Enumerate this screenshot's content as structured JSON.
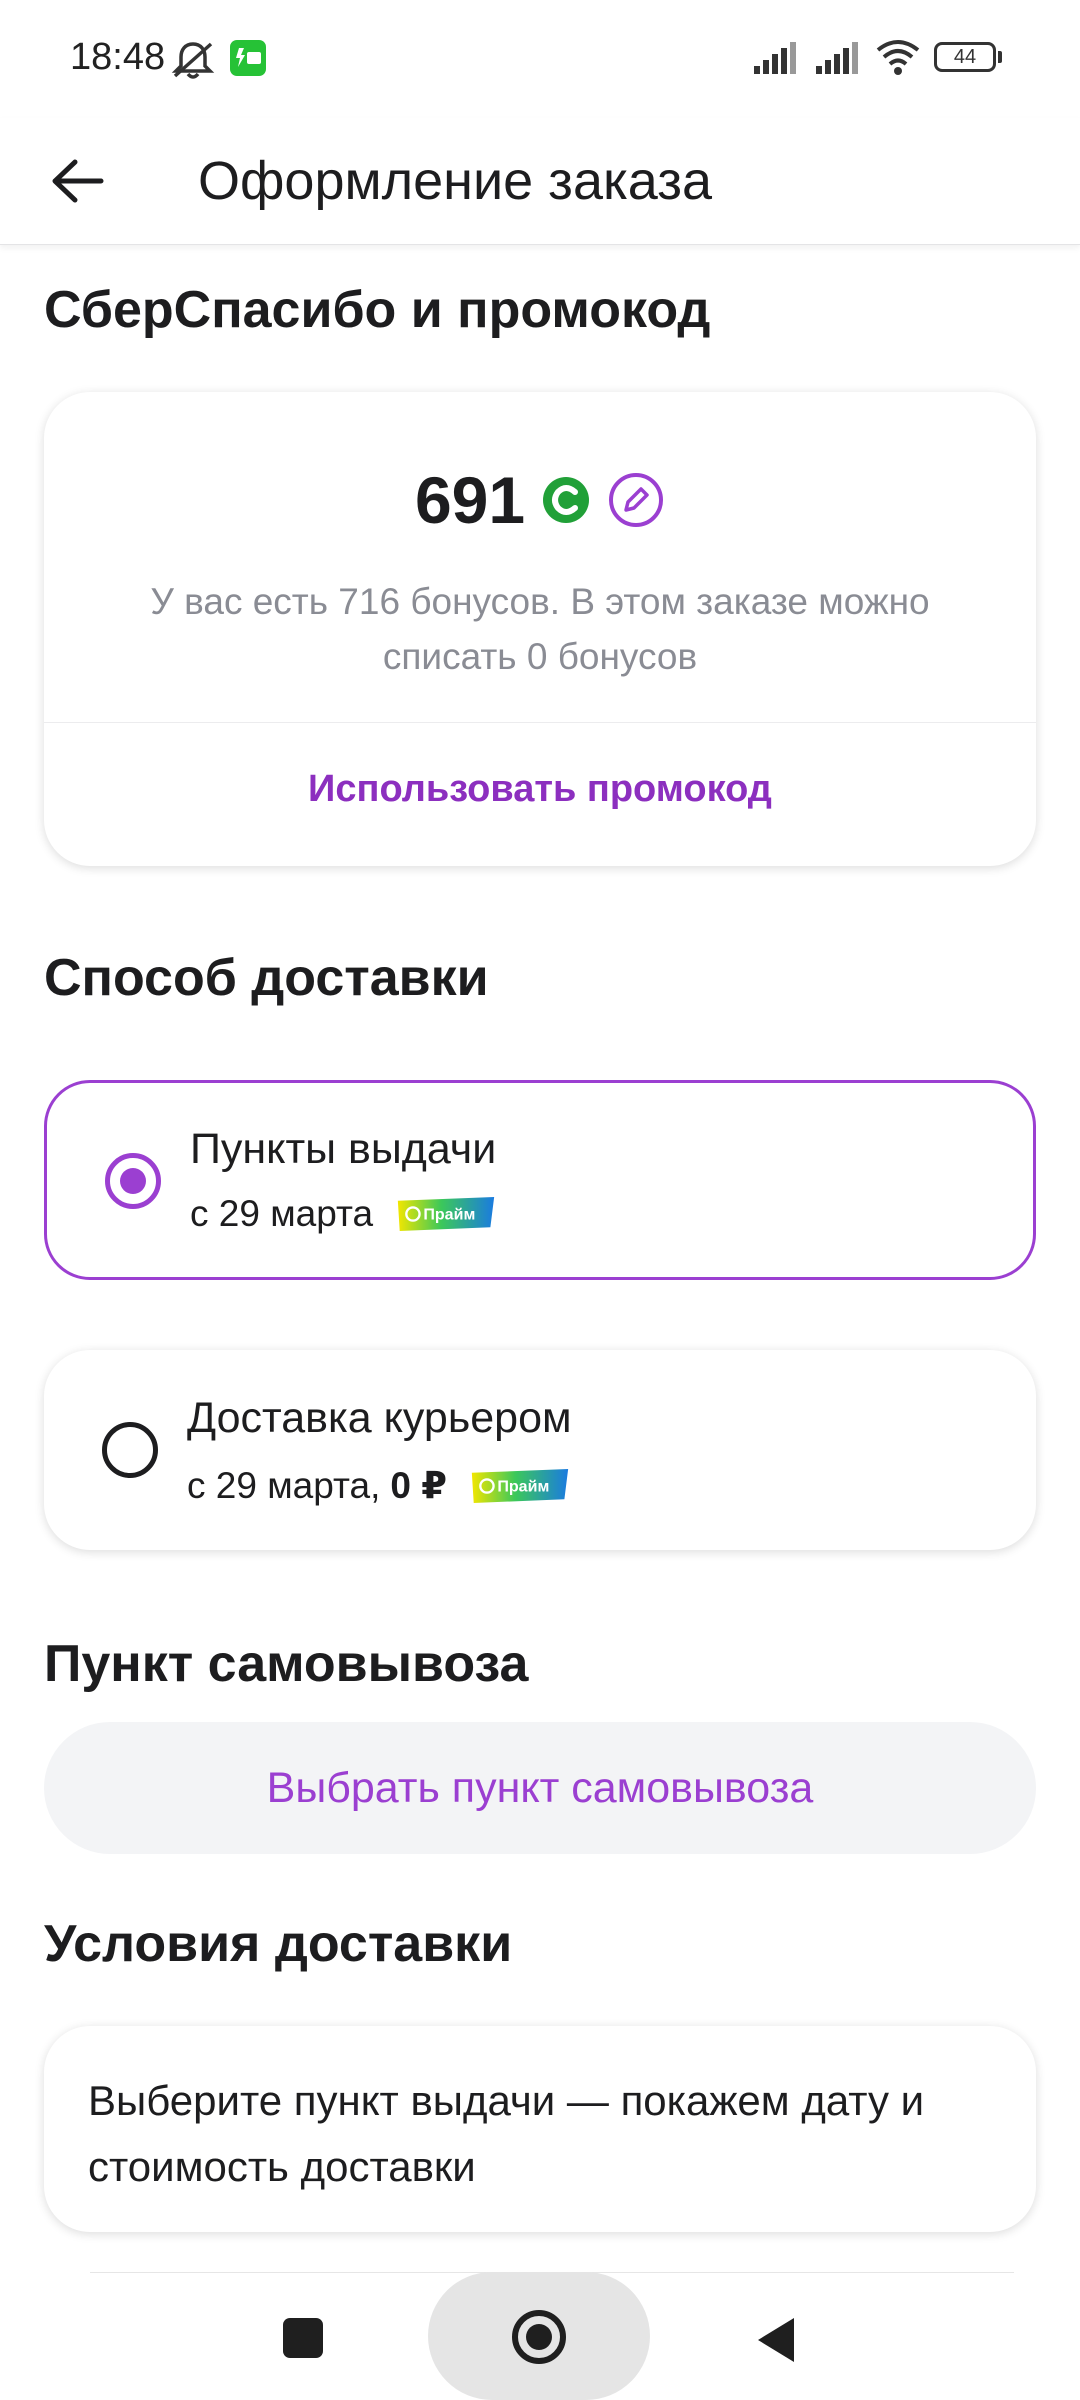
{
  "status_bar": {
    "time": "18:48",
    "battery": "44"
  },
  "app_bar": {
    "title": "Оформление заказа"
  },
  "bonus_section": {
    "title": "СберСпасибо и промокод",
    "bonus_value": "691",
    "bonus_text": "У вас есть 716 бонусов. В этом заказе можно списать 0 бонусов",
    "promo_link": "Использовать промокод"
  },
  "delivery_section": {
    "title": "Способ доставки",
    "options": [
      {
        "title": "Пункты выдачи",
        "subtitle": "с 29 марта",
        "price": "",
        "badge": "Прайм",
        "selected": true
      },
      {
        "title": "Доставка курьером",
        "subtitle": "с 29 марта,",
        "price": "0 ₽",
        "badge": "Прайм",
        "selected": false
      }
    ]
  },
  "pickup_section": {
    "title": "Пункт самовывоза",
    "button": "Выбрать пункт самовывоза"
  },
  "conditions_section": {
    "title": "Условия доставки",
    "text": "Выберите пункт выдачи — покажем дату и стоимость доставки"
  },
  "colors": {
    "accent": "#9b3fd1",
    "link": "#8c2fbf",
    "sber_green": "#21a038"
  }
}
